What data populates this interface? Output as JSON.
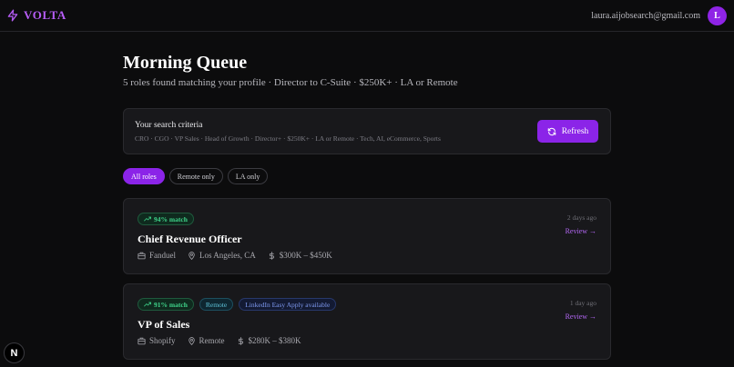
{
  "header": {
    "brand": "VOLTA",
    "brand_icon": "lightning-bolt-icon",
    "email": "laura.aijobsearch@gmail.com",
    "avatar_initial": "L"
  },
  "page": {
    "title": "Morning Queue",
    "subtitle": "5 roles found matching your profile · Director to C-Suite · $250K+ · LA or Remote"
  },
  "criteria": {
    "label": "Your search criteria",
    "values": "CRO · CGO · VP Sales · Head of Growth · Director+ · $250K+ · LA or Remote · Tech, AI, eCommerce, Sports",
    "refresh_label": "Refresh"
  },
  "filters": [
    {
      "label": "All roles",
      "active": true
    },
    {
      "label": "Remote only",
      "active": false
    },
    {
      "label": "LA only",
      "active": false
    }
  ],
  "jobs": [
    {
      "match": "94% match",
      "title": "Chief Revenue Officer",
      "company": "Fanduel",
      "location": "Los Angeles, CA",
      "salary": "$300K – $450K",
      "posted": "2 days ago",
      "review": "Review →"
    },
    {
      "match": "91% match",
      "tags": [
        "Remote",
        "LinkedIn Easy Apply available"
      ],
      "title": "VP of Sales",
      "company": "Shopify",
      "location": "Remote",
      "salary": "$280K – $380K",
      "posted": "1 day ago",
      "review": "Review →"
    }
  ],
  "dev_badge": "N",
  "colors": {
    "accent": "#8b24e8",
    "match_green": "#3fd48a",
    "remote_teal": "#5fc6dc",
    "easy_apply_blue": "#7d98ef"
  }
}
